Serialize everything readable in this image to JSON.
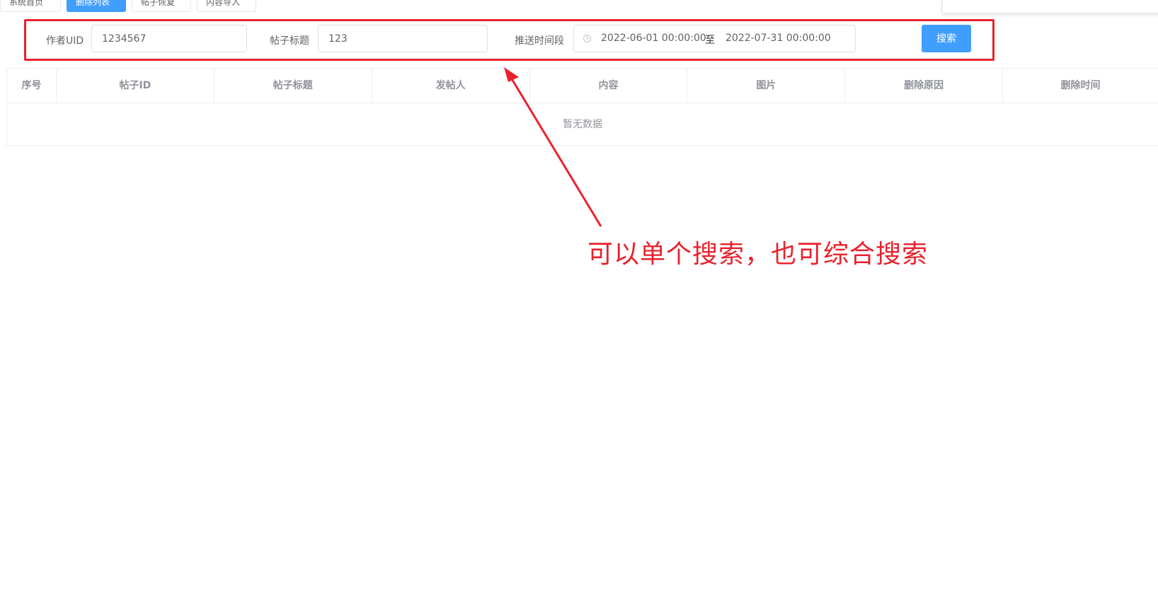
{
  "tabs": [
    {
      "label": "系统首页",
      "active": false
    },
    {
      "label": "删除列表",
      "active": true
    },
    {
      "label": "帖子恢复",
      "active": false
    },
    {
      "label": "内容导入",
      "active": false
    }
  ],
  "form": {
    "uid_label": "作者UID",
    "uid_value": "1234567",
    "title_label": "帖子标题",
    "title_value": "123",
    "time_label": "推送时间段",
    "start_time": "2022-06-01 00:00:00",
    "range_separator": "至",
    "end_time": "2022-07-31 00:00:00",
    "search_button": "搜索"
  },
  "table": {
    "headers": [
      "序号",
      "帖子ID",
      "帖子标题",
      "发帖人",
      "内容",
      "图片",
      "删除原因",
      "删除时间"
    ],
    "empty_text": "暂无数据"
  },
  "annotation": {
    "text": "可以单个搜索，也可综合搜索",
    "color": "#e8222d"
  },
  "colors": {
    "primary": "#409eff",
    "border": "#dcdfe6",
    "header_text": "#909399"
  }
}
